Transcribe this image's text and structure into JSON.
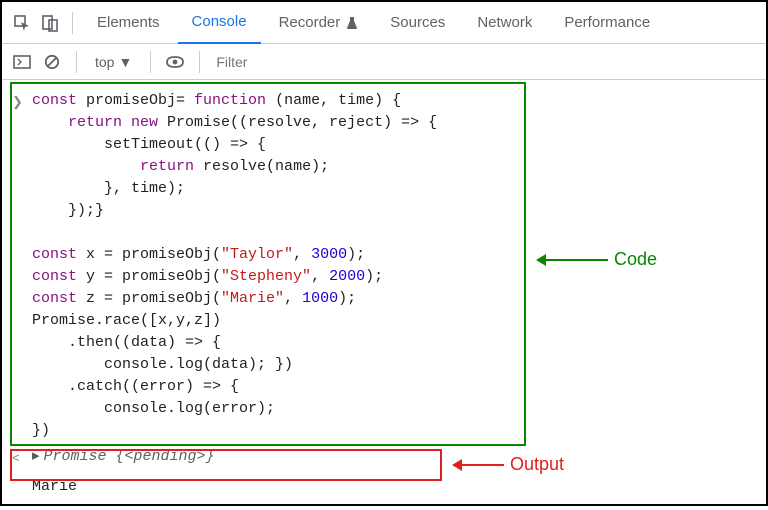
{
  "tabs": {
    "elements": "Elements",
    "console": "Console",
    "recorder": "Recorder",
    "sources": "Sources",
    "network": "Network",
    "performance": "Performance"
  },
  "subbar": {
    "context": "top",
    "filter_placeholder": "Filter"
  },
  "code_lines": {
    "l1a": "const",
    "l1b": " promiseObj= ",
    "l1c": "function",
    "l1d": " (name, time) {",
    "l2a": "    ",
    "l2b": "return new",
    "l2c": " Promise((resolve, reject) => {",
    "l3": "        setTimeout(() => {",
    "l4a": "            ",
    "l4b": "return",
    "l4c": " resolve(name);",
    "l5": "        }, time);",
    "l6": "    });}",
    "blank": "",
    "l7a": "const",
    "l7b": " x = promiseObj(",
    "l7c": "\"Taylor\"",
    "l7d": ", ",
    "l7e": "3000",
    "l7f": ");",
    "l8a": "const",
    "l8b": " y = promiseObj(",
    "l8c": "\"Stepheny\"",
    "l8d": ", ",
    "l8e": "2000",
    "l8f": ");",
    "l9a": "const",
    "l9b": " z = promiseObj(",
    "l9c": "\"Marie\"",
    "l9d": ", ",
    "l9e": "1000",
    "l9f": ");",
    "l10": "Promise.race([x,y,z])",
    "l11": "    .then((data) => {",
    "l12": "        console.log(data); })",
    "l13": "    .catch((error) => {",
    "l14": "        console.log(error);",
    "l15": "})"
  },
  "result_line": "Promise {<pending>}",
  "output_value": "Marie",
  "annotations": {
    "code_label": "Code",
    "output_label": "Output"
  }
}
